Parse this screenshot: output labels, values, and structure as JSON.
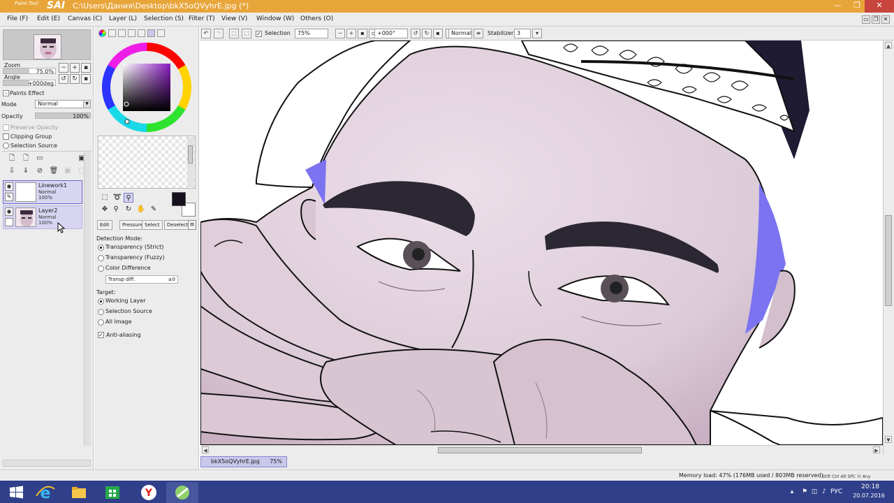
{
  "window": {
    "logo_small": "Paint Tool",
    "logo_big": "SAI",
    "title": "C:\\Users\\Дания\\Desktop\\bkX5oQVyhrE.jpg (*)",
    "controls": [
      "—",
      "❐",
      "✕"
    ]
  },
  "menu": {
    "items": [
      "File (F)",
      "Edit (E)",
      "Canvas (C)",
      "Layer (L)",
      "Selection (S)",
      "Filter (T)",
      "View (V)",
      "Window (W)",
      "Others (O)"
    ]
  },
  "navigator": {
    "zoom_label": "Zoom",
    "zoom_value": "75.0%",
    "angle_label": "Angle",
    "angle_value": "+000deg"
  },
  "layer_props": {
    "paints_effect": "Paints Effect",
    "mode_label": "Mode",
    "mode_value": "Normal",
    "opacity_label": "Opacity",
    "opacity_value": "100%",
    "opacity_fraction": 1.0,
    "preserve_opacity": "Preserve Opacity",
    "clipping_group": "Clipping Group",
    "selection_source": "Selection Source"
  },
  "layers": [
    {
      "name": "Linework1",
      "mode": "Normal",
      "opacity": "100%",
      "active": true
    },
    {
      "name": "Layer2",
      "mode": "Normal",
      "opacity": "100%",
      "active": false
    }
  ],
  "tools": {
    "subtabs": [
      "Edit",
      "Pressure",
      "Select",
      "Deselect"
    ],
    "detection_mode_label": "Detection Mode:",
    "detection_options": [
      "Transparency (Strict)",
      "Transparency (Fuzzy)",
      "Color Difference"
    ],
    "detection_selected": 0,
    "transp_diff_label": "Transp diff.",
    "transp_diff_value": "±0",
    "target_label": "Target:",
    "target_options": [
      "Working Layer",
      "Selection Source",
      "All Image"
    ],
    "target_selected": 0,
    "anti_aliasing": "Anti-aliasing",
    "anti_aliasing_checked": true,
    "primary_color": "#17111f",
    "secondary_color": "#ffffff"
  },
  "canvas_toolbar": {
    "selection_label": "Selection",
    "zoom": "75%",
    "angle": "+000°",
    "blend": "Normal",
    "stabilizer_label": "Stabilizer",
    "stabilizer_value": "3"
  },
  "doc_tab": {
    "name": "bkX5oQVyhrE.jpg",
    "zoom": "75%"
  },
  "status": {
    "memory": "Memory load: 47% (176MB used / 803MB reserved)",
    "keys": "Shft Ctrl Alt SPC ⓦ Any"
  },
  "taskbar": {
    "lang": "РУС",
    "time": "20:18",
    "date": "20.07.2016"
  },
  "colors": {
    "titlebar": "#e8a53a",
    "taskbar": "#2f3f8a",
    "layer_selected": "#d7d5f2",
    "skin": "#e2d2de",
    "accent_blue": "#7b73f0"
  }
}
